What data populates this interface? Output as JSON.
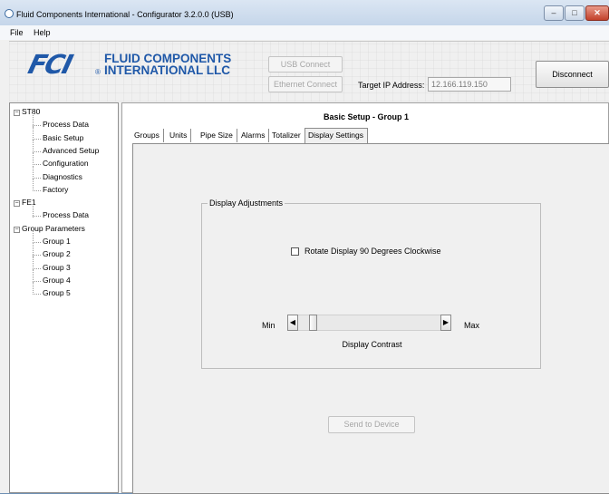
{
  "window": {
    "title": "Fluid Components International - Configurator 3.2.0.0 (USB)",
    "controls": {
      "minimize": "–",
      "maximize": "□",
      "close": "✕"
    }
  },
  "menubar": {
    "items": [
      "File",
      "Help"
    ]
  },
  "logo": {
    "mark": "FCI",
    "registered": "®",
    "line1": "FLUID COMPONENTS",
    "line2": "INTERNATIONAL LLC"
  },
  "connection": {
    "usb_label": "USB Connect",
    "ethernet_label": "Ethernet Connect",
    "ip_label": "Target IP Address:",
    "ip_value": "12.166.119.150",
    "disconnect_label": "Disconnect"
  },
  "tree": [
    {
      "label": "ST80",
      "expander": "−",
      "level": 0
    },
    {
      "label": "Process Data",
      "level": 1
    },
    {
      "label": "Basic Setup",
      "level": 1
    },
    {
      "label": "Advanced Setup",
      "level": 1
    },
    {
      "label": "Configuration",
      "level": 1
    },
    {
      "label": "Diagnostics",
      "level": 1
    },
    {
      "label": "Factory",
      "level": 1
    },
    {
      "label": "FE1",
      "expander": "−",
      "level": 0
    },
    {
      "label": "Process Data",
      "level": 1
    },
    {
      "label": "Group Parameters",
      "expander": "−",
      "level": 0
    },
    {
      "label": "Group 1",
      "level": 1
    },
    {
      "label": "Group 2",
      "level": 1
    },
    {
      "label": "Group 3",
      "level": 1
    },
    {
      "label": "Group 4",
      "level": 1
    },
    {
      "label": "Group 5",
      "level": 1
    }
  ],
  "panel": {
    "title": "Basic Setup - Group 1",
    "tabs": [
      "Groups",
      "Units",
      "Pipe Size",
      "Alarms",
      "Totalizer",
      "Display Settings"
    ],
    "active_tab": "Display Settings",
    "display_adjustments": {
      "group_title": "Display Adjustments",
      "rotate_label": "Rotate Display 90 Degrees Clockwise",
      "rotate_checked": false,
      "contrast": {
        "min_label": "Min",
        "max_label": "Max",
        "caption": "Display Contrast",
        "value_fraction": 0.08,
        "left_arrow": "◀",
        "right_arrow": "▶"
      }
    },
    "send_label": "Send to Device"
  }
}
